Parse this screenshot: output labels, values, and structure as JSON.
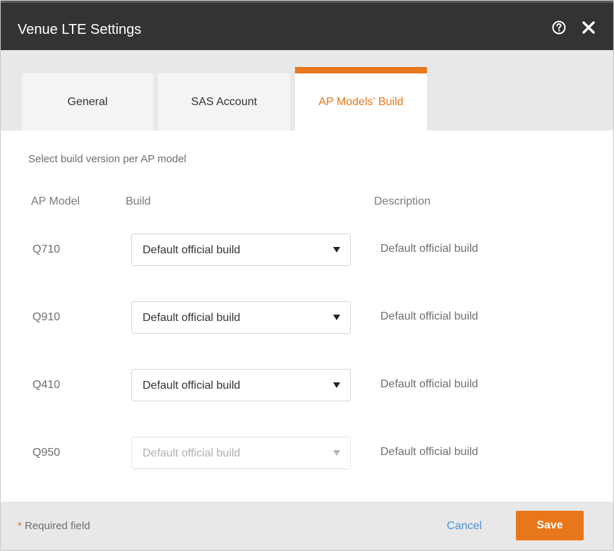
{
  "dialog": {
    "title": "Venue LTE Settings"
  },
  "header": {
    "help_icon": "help-circle-icon",
    "close_icon": "close-icon"
  },
  "tabs": [
    {
      "label": "General",
      "active": false
    },
    {
      "label": "SAS Account",
      "active": false
    },
    {
      "label": "AP Models' Build",
      "active": true
    }
  ],
  "content": {
    "hint": "Select build version per AP model",
    "columns": {
      "model": "AP Model",
      "build": "Build",
      "description": "Description"
    },
    "rows": [
      {
        "model": "Q710",
        "build": "Default official build",
        "description": "Default official build",
        "disabled": false
      },
      {
        "model": "Q910",
        "build": "Default official build",
        "description": "Default official build",
        "disabled": false
      },
      {
        "model": "Q410",
        "build": "Default official build",
        "description": "Default official build",
        "disabled": false
      },
      {
        "model": "Q950",
        "build": "Default official build",
        "description": "Default official build",
        "disabled": true
      }
    ]
  },
  "footer": {
    "required_star": "*",
    "required_label": " Required field",
    "cancel_label": "Cancel",
    "save_label": "Save"
  },
  "colors": {
    "accent": "#e8761a",
    "header_bg": "#333333",
    "link": "#4a90d9"
  }
}
